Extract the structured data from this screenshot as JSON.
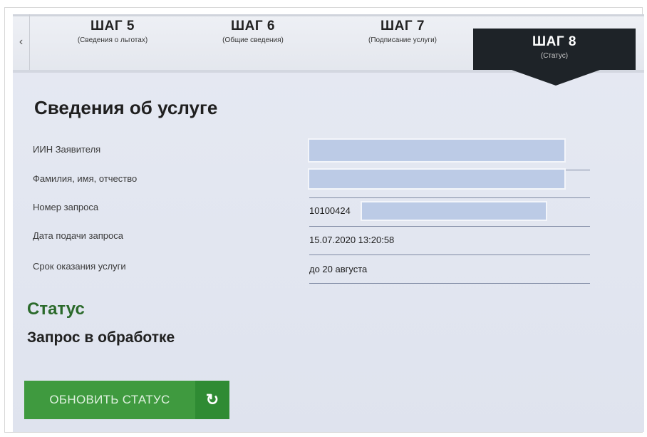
{
  "steps": [
    {
      "num": "ШАГ 5",
      "sub": "(Сведения о льготах)"
    },
    {
      "num": "ШАГ 6",
      "sub": "(Общие сведения)"
    },
    {
      "num": "ШАГ 7",
      "sub": "(Подписание услуги)"
    },
    {
      "num": "ШАГ 8",
      "sub": "(Статус)"
    }
  ],
  "nav": {
    "prev_icon": "chevron-left-icon",
    "prev_glyph": "‹"
  },
  "section": {
    "title": "Сведения об услуге"
  },
  "fields": [
    {
      "label": "ИИН Заявителя",
      "value": ""
    },
    {
      "label": "Фамилия, имя, отчество",
      "value": ""
    },
    {
      "label": "Номер запроса",
      "value": "10100424"
    },
    {
      "label": "Дата подачи запроса",
      "value": "15.07.2020 13:20:58"
    },
    {
      "label": "Срок оказания услуги",
      "value": "до 20 августа"
    }
  ],
  "status": {
    "heading": "Статус",
    "value": "Запрос в обработке"
  },
  "refresh_button": {
    "label": "ОБНОВИТЬ СТАТУС",
    "icon": "refresh-icon",
    "glyph": "↻"
  },
  "colors": {
    "active_step": "#1e2328",
    "status_heading": "#2b6a2b",
    "button": "#3f9a3f",
    "masked": "#bccbe6"
  }
}
